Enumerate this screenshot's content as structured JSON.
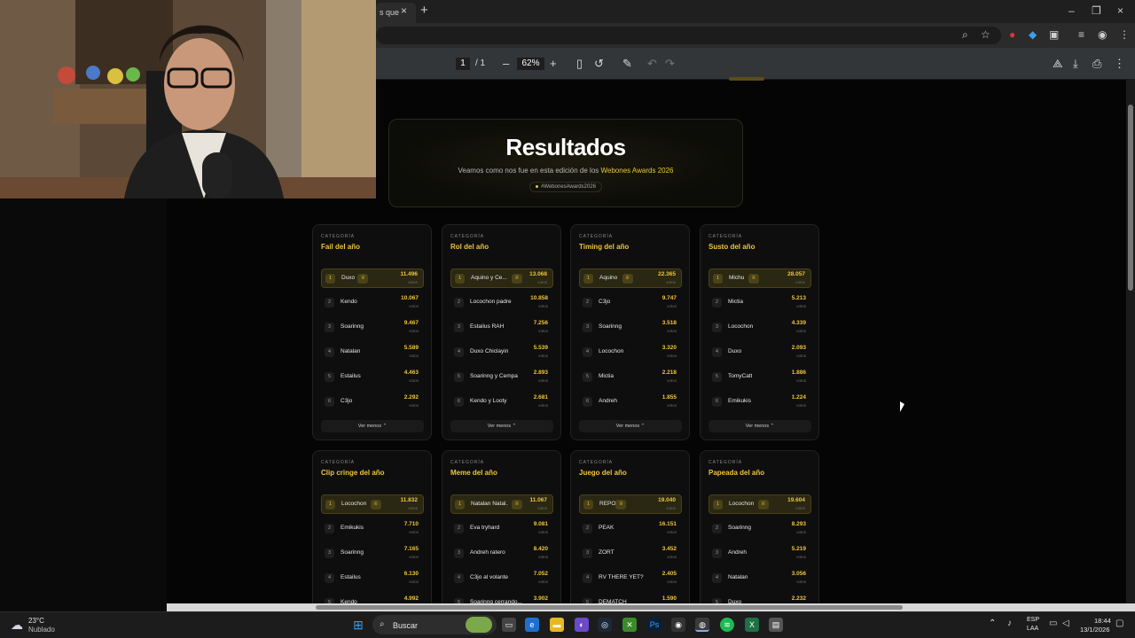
{
  "browser": {
    "tab_title": "s que",
    "tab_close": "×",
    "new_tab": "+",
    "window_controls": [
      "–",
      "❐",
      "×"
    ]
  },
  "pdf_toolbar": {
    "page_current": "1",
    "page_total": "/ 1",
    "zoom_out": "–",
    "zoom_value": "62%",
    "zoom_in": "+"
  },
  "hero": {
    "title": "Resultados",
    "subtitle_prefix": "Veamos como nos fue en esta edición de los ",
    "subtitle_highlight": "Webones Awards 2026",
    "hashtag": "#WebonesAwards2026"
  },
  "labels": {
    "category": "CATEGORÍA",
    "votes": "votos",
    "show_less": "Ver menos ⌃"
  },
  "categories": [
    {
      "title": "Fail del año",
      "entries": [
        {
          "rank": "1",
          "name": "Duxo",
          "votes": "11.496"
        },
        {
          "rank": "2",
          "name": "Kendo",
          "votes": "10.067"
        },
        {
          "rank": "3",
          "name": "Soarinng",
          "votes": "9.467"
        },
        {
          "rank": "4",
          "name": "Natalan",
          "votes": "5.589"
        },
        {
          "rank": "5",
          "name": "Estailus",
          "votes": "4.463"
        },
        {
          "rank": "6",
          "name": "C3jo",
          "votes": "2.292"
        }
      ]
    },
    {
      "title": "Rol del año",
      "entries": [
        {
          "rank": "1",
          "name": "Aquino y Ce...",
          "votes": "13.068"
        },
        {
          "rank": "2",
          "name": "Locochon padre",
          "votes": "10.858"
        },
        {
          "rank": "3",
          "name": "Estailus RAH",
          "votes": "7.256"
        },
        {
          "rank": "4",
          "name": "Duxo Chiclayin",
          "votes": "5.539"
        },
        {
          "rank": "5",
          "name": "Soarinng y Cempa",
          "votes": "2.893"
        },
        {
          "rank": "6",
          "name": "Kendo y Looty",
          "votes": "2.681"
        }
      ]
    },
    {
      "title": "Timing del año",
      "entries": [
        {
          "rank": "1",
          "name": "Aquino",
          "votes": "22.365"
        },
        {
          "rank": "2",
          "name": "C3jo",
          "votes": "9.747"
        },
        {
          "rank": "3",
          "name": "Soarinng",
          "votes": "3.518"
        },
        {
          "rank": "4",
          "name": "Locochon",
          "votes": "3.320"
        },
        {
          "rank": "5",
          "name": "Mictia",
          "votes": "2.218"
        },
        {
          "rank": "6",
          "name": "Andreh",
          "votes": "1.855"
        }
      ]
    },
    {
      "title": "Susto del año",
      "entries": [
        {
          "rank": "1",
          "name": "Michu",
          "votes": "28.057"
        },
        {
          "rank": "2",
          "name": "Mictia",
          "votes": "5.213"
        },
        {
          "rank": "3",
          "name": "Locochon",
          "votes": "4.339"
        },
        {
          "rank": "4",
          "name": "Duxo",
          "votes": "2.093"
        },
        {
          "rank": "5",
          "name": "TomyCatt",
          "votes": "1.886"
        },
        {
          "rank": "6",
          "name": "Emikukis",
          "votes": "1.224"
        }
      ]
    },
    {
      "title": "Clip cringe del año",
      "entries": [
        {
          "rank": "1",
          "name": "Locochon",
          "votes": "11.832"
        },
        {
          "rank": "2",
          "name": "Emikukis",
          "votes": "7.710"
        },
        {
          "rank": "3",
          "name": "Soarinng",
          "votes": "7.165"
        },
        {
          "rank": "4",
          "name": "Estailus",
          "votes": "6.130"
        },
        {
          "rank": "5",
          "name": "Kendo",
          "votes": "4.992"
        }
      ]
    },
    {
      "title": "Meme del año",
      "entries": [
        {
          "rank": "1",
          "name": "Natalan Natal...",
          "votes": "11.067"
        },
        {
          "rank": "2",
          "name": "Eva tryhard",
          "votes": "9.081"
        },
        {
          "rank": "3",
          "name": "Andreh ratero",
          "votes": "8.420"
        },
        {
          "rank": "4",
          "name": "C3jo al volante",
          "votes": "7.052"
        },
        {
          "rank": "5",
          "name": "Soarinng cerrando...",
          "votes": "3.902"
        }
      ]
    },
    {
      "title": "Juego del año",
      "entries": [
        {
          "rank": "1",
          "name": "REPO",
          "votes": "19.040"
        },
        {
          "rank": "2",
          "name": "PEAK",
          "votes": "16.151"
        },
        {
          "rank": "3",
          "name": "ZORT",
          "votes": "3.452"
        },
        {
          "rank": "4",
          "name": "RV THERE YET?",
          "votes": "2.405"
        },
        {
          "rank": "5",
          "name": "DEMATCH",
          "votes": "1.590"
        }
      ]
    },
    {
      "title": "Papeada del año",
      "entries": [
        {
          "rank": "1",
          "name": "Locochon",
          "votes": "19.604"
        },
        {
          "rank": "2",
          "name": "Soarinng",
          "votes": "8.293"
        },
        {
          "rank": "3",
          "name": "Andreh",
          "votes": "5.219"
        },
        {
          "rank": "4",
          "name": "Natalan",
          "votes": "3.056"
        },
        {
          "rank": "5",
          "name": "Duxo",
          "votes": "2.232"
        }
      ]
    }
  ],
  "taskbar": {
    "weather_temp": "23°C",
    "weather_desc": "Nublado",
    "search_label": "Buscar",
    "lang_top": "ESP",
    "lang_bottom": "LAA",
    "time": "18:44",
    "date": "13/1/2026"
  },
  "colors": {
    "accent": "#f0c53a",
    "background": "#050505",
    "card": "#0e0e0e"
  }
}
